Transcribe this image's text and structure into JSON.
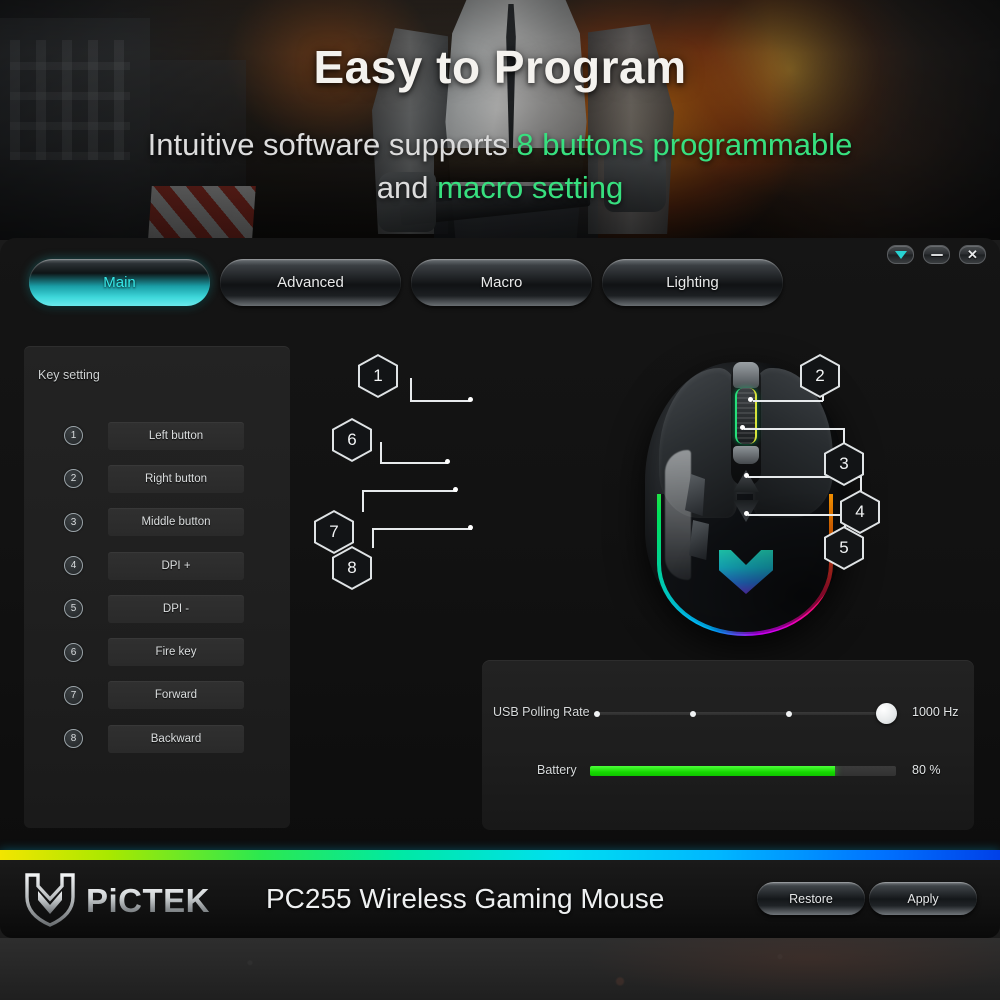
{
  "hero": {
    "title": "Easy to Program",
    "subtitle_part1": "Intuitive software supports ",
    "subtitle_hl1": "8 buttons programmable",
    "subtitle_part2": "and ",
    "subtitle_hl2": "macro setting",
    "highlight_color": "#37e07f"
  },
  "window": {
    "controls": [
      {
        "name": "collapse",
        "glyph": "▼"
      },
      {
        "name": "minimize",
        "glyph": "–"
      },
      {
        "name": "close",
        "glyph": "✕"
      }
    ]
  },
  "tabs": [
    {
      "label": "Main",
      "active": true
    },
    {
      "label": "Advanced",
      "active": false
    },
    {
      "label": "Macro",
      "active": false
    },
    {
      "label": "Lighting",
      "active": false
    }
  ],
  "key_setting": {
    "title": "Key setting",
    "rows": [
      {
        "number": "1",
        "label": "Left button"
      },
      {
        "number": "2",
        "label": "Right button"
      },
      {
        "number": "3",
        "label": "Middle button"
      },
      {
        "number": "4",
        "label": "DPI +"
      },
      {
        "number": "5",
        "label": "DPI -"
      },
      {
        "number": "6",
        "label": "Fire key"
      },
      {
        "number": "7",
        "label": "Forward"
      },
      {
        "number": "8",
        "label": "Backward"
      }
    ]
  },
  "mouse_callouts": [
    {
      "number": "1"
    },
    {
      "number": "2"
    },
    {
      "number": "3"
    },
    {
      "number": "4"
    },
    {
      "number": "5"
    },
    {
      "number": "6"
    },
    {
      "number": "7"
    },
    {
      "number": "8"
    }
  ],
  "settings": {
    "polling": {
      "label": "USB Polling Rate",
      "value": "1000 Hz",
      "steps": 4,
      "selected_index": 4
    },
    "battery": {
      "label": "Battery",
      "value": "80 %",
      "percent": 80,
      "fill_color": "#16d900"
    }
  },
  "footer": {
    "brand": "PiCTEK",
    "model": "PC255 Wireless Gaming Mouse",
    "restore_label": "Restore",
    "apply_label": "Apply"
  }
}
